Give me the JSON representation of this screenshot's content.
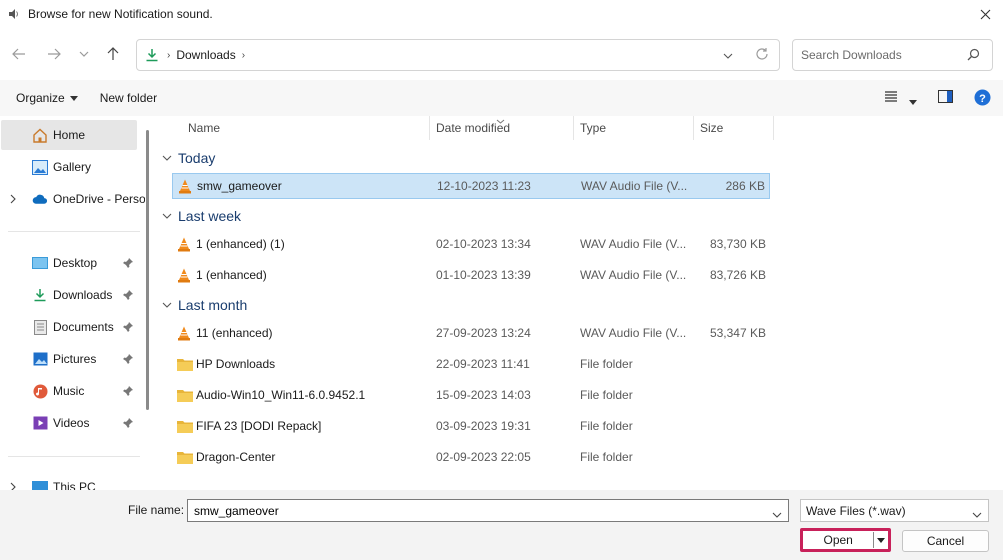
{
  "window": {
    "title": "Browse for new Notification sound.",
    "icons": {
      "app": "speaker-icon",
      "close": "close-icon"
    }
  },
  "navigation": {
    "back_icon": "arrow-left-icon",
    "forward_icon": "arrow-right-icon",
    "recent_icon": "chevron-down-icon",
    "up_icon": "arrow-up-icon",
    "address": {
      "icon": "download-icon",
      "crumbs": [
        "Downloads"
      ]
    },
    "search": {
      "placeholder": "Search Downloads",
      "value": ""
    }
  },
  "commandbar": {
    "organize_label": "Organize",
    "newfolder_label": "New folder",
    "icons": [
      "view-details-icon",
      "preview-pane-icon",
      "help-icon"
    ]
  },
  "sidebar": {
    "items": [
      {
        "label": "Home",
        "icon": "home-icon",
        "selected": true
      },
      {
        "label": "Gallery",
        "icon": "gallery-icon"
      },
      {
        "label": "OneDrive - Perso",
        "icon": "cloud-icon",
        "expandable": true
      },
      {
        "label": "Desktop",
        "icon": "desktop-icon",
        "pinned": true
      },
      {
        "label": "Downloads",
        "icon": "download-icon",
        "pinned": true
      },
      {
        "label": "Documents",
        "icon": "document-icon",
        "pinned": true
      },
      {
        "label": "Pictures",
        "icon": "pictures-icon",
        "pinned": true
      },
      {
        "label": "Music",
        "icon": "music-icon",
        "pinned": true
      },
      {
        "label": "Videos",
        "icon": "video-icon",
        "pinned": true
      },
      {
        "label": "This PC",
        "icon": "computer-icon",
        "expandable": true
      }
    ]
  },
  "filelist": {
    "columns": [
      "Name",
      "Date modified",
      "Type",
      "Size"
    ],
    "groups": [
      {
        "label": "Today",
        "files": [
          {
            "name": "smw_gameover",
            "date": "12-10-2023 11:23",
            "type": "WAV Audio File (V...",
            "size": "286 KB",
            "icon": "vlc-icon",
            "selected": true
          }
        ]
      },
      {
        "label": "Last week",
        "files": [
          {
            "name": "1 (enhanced) (1)",
            "date": "02-10-2023 13:34",
            "type": "WAV Audio File (V...",
            "size": "83,730 KB",
            "icon": "vlc-icon"
          },
          {
            "name": "1 (enhanced)",
            "date": "01-10-2023 13:39",
            "type": "WAV Audio File (V...",
            "size": "83,726 KB",
            "icon": "vlc-icon"
          }
        ]
      },
      {
        "label": "Last month",
        "files": [
          {
            "name": "11 (enhanced)",
            "date": "27-09-2023 13:24",
            "type": "WAV Audio File (V...",
            "size": "53,347 KB",
            "icon": "vlc-icon"
          },
          {
            "name": "HP Downloads",
            "date": "22-09-2023 11:41",
            "type": "File folder",
            "size": "",
            "icon": "folder-icon"
          },
          {
            "name": "Audio-Win10_Win11-6.0.9452.1",
            "date": "15-09-2023 14:03",
            "type": "File folder",
            "size": "",
            "icon": "folder-icon"
          },
          {
            "name": "FIFA 23 [DODI Repack]",
            "date": "03-09-2023 19:31",
            "type": "File folder",
            "size": "",
            "icon": "folder-icon"
          },
          {
            "name": "Dragon-Center",
            "date": "02-09-2023 22:05",
            "type": "File folder",
            "size": "",
            "icon": "folder-icon"
          }
        ]
      }
    ]
  },
  "bottom": {
    "filename_label": "File name:",
    "filename_value": "smw_gameover",
    "filetype_value": "Wave Files (*.wav)",
    "open_label": "Open",
    "cancel_label": "Cancel",
    "highlight_color": "#c8215a"
  }
}
